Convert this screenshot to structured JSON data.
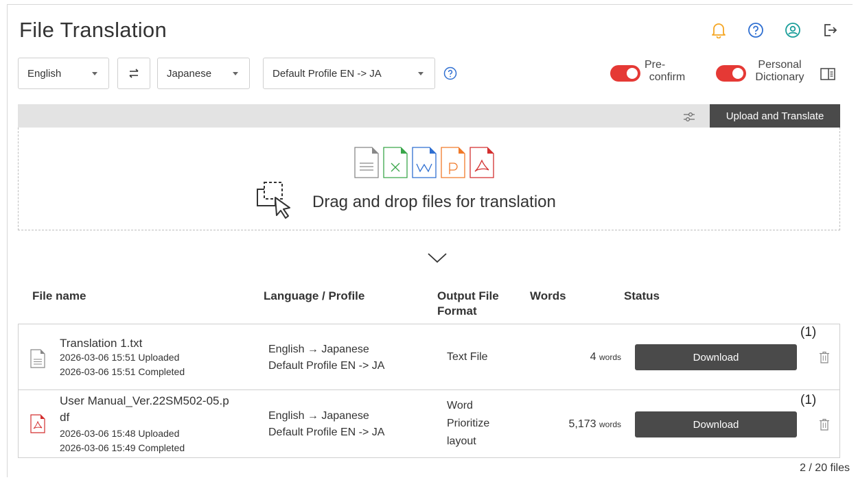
{
  "page": {
    "title": "File Translation"
  },
  "header_icons": [
    "bell-icon",
    "help-icon",
    "user-icon",
    "logout-icon"
  ],
  "controls": {
    "source_language": "English",
    "target_language": "Japanese",
    "profile": "Default Profile EN -> JA",
    "preconfirm": {
      "label_line1": "Pre-",
      "label_line2": "confirm",
      "enabled": true
    },
    "personal_dictionary": {
      "label_line1": "Personal",
      "label_line2": "Dictionary",
      "enabled": true
    }
  },
  "toolbar": {
    "upload_label": "Upload and Translate"
  },
  "dropzone": {
    "text": "Drag and drop files for translation",
    "file_types": [
      "txt",
      "xlsx",
      "docx",
      "pptx",
      "pdf"
    ]
  },
  "table": {
    "headers": {
      "file_name": "File name",
      "language_profile": "Language / Profile",
      "output_format_line1": "Output File",
      "output_format_line2": "Format",
      "words": "Words",
      "status": "Status"
    },
    "rows": [
      {
        "file_type": "txt",
        "name_line1": "Translation 1.txt",
        "name_line2": "",
        "uploaded": "2026-03-06 15:51 Uploaded",
        "completed": "2026-03-06 15:51 Completed",
        "language": "English → Japanese",
        "profile": "Default Profile EN -> JA",
        "format_line1": "Text File",
        "format_line2": "",
        "format_line3": "",
        "words_count": "4",
        "words_unit": "words",
        "action": "Download",
        "count": "(1)"
      },
      {
        "file_type": "pdf",
        "name_line1": "User Manual_Ver.22SM502-05.p",
        "name_line2": "df",
        "uploaded": "2026-03-06 15:48 Uploaded",
        "completed": "2026-03-06 15:49 Completed",
        "language": "English → Japanese",
        "profile": "Default Profile EN -> JA",
        "format_line1": "Word",
        "format_line2": "Prioritize",
        "format_line3": "layout",
        "words_count": "5,173",
        "words_unit": "words",
        "action": "Download",
        "count": "(1)"
      }
    ]
  },
  "pager": {
    "text": "2 / 20 files"
  },
  "colors": {
    "accent_orange": "#f5a623",
    "accent_teal": "#1a9e9a",
    "help_blue": "#2f6fd1",
    "toggle_red": "#e53935",
    "button_dark": "#4a4a4a"
  }
}
